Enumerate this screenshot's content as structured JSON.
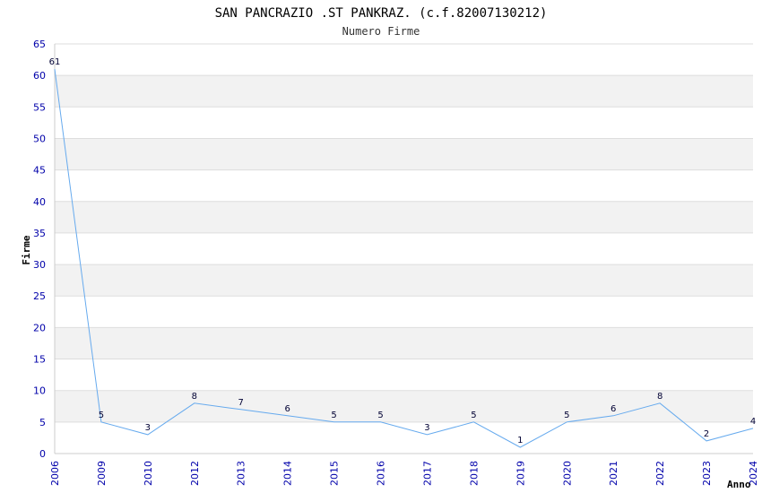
{
  "chart_data": {
    "type": "line",
    "title": "SAN PANCRAZIO .ST PANKRAZ. (c.f.82007130212)",
    "subtitle": "Numero Firme",
    "xlabel": "Anno",
    "ylabel": "Firme",
    "categories": [
      "2006",
      "2009",
      "2010",
      "2012",
      "2013",
      "2014",
      "2015",
      "2016",
      "2017",
      "2018",
      "2019",
      "2020",
      "2021",
      "2022",
      "2023",
      "2024"
    ],
    "series": [
      {
        "values": [
          61,
          5,
          3,
          8,
          7,
          6,
          5,
          5,
          3,
          5,
          1,
          5,
          6,
          8,
          2,
          4
        ]
      }
    ],
    "ylim": [
      0,
      65
    ],
    "yticks": [
      0,
      5,
      10,
      15,
      20,
      25,
      30,
      35,
      40,
      45,
      50,
      55,
      60,
      65
    ],
    "grid": true,
    "colors": {
      "line": "#66aaee",
      "band": "#f2f2f2",
      "gridline": "#dddddd",
      "tick": "#0000aa"
    }
  }
}
